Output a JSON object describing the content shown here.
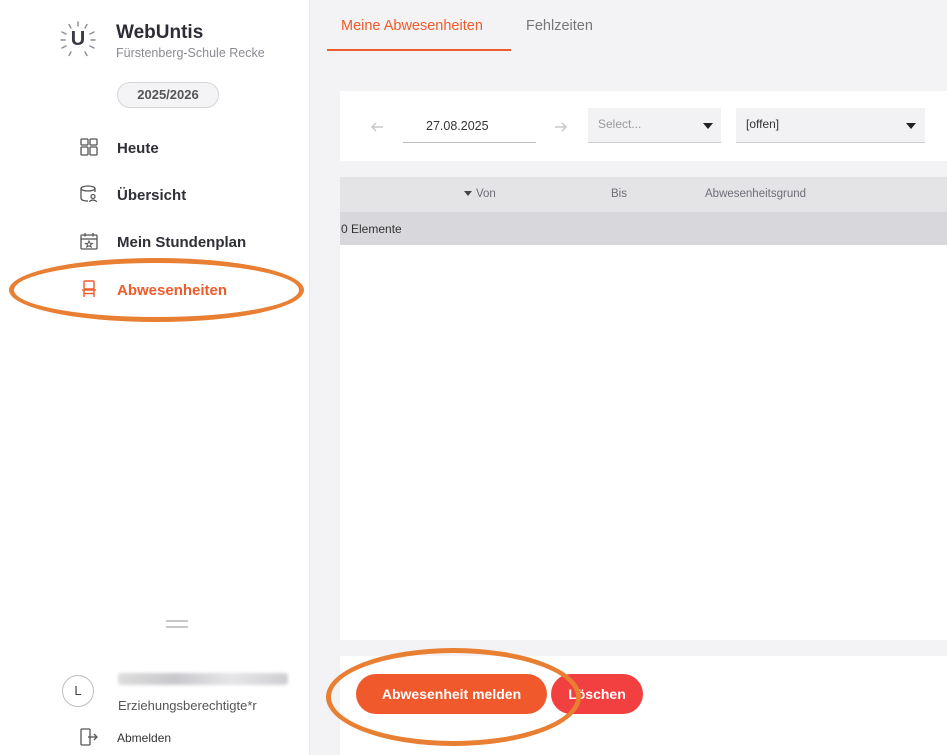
{
  "app": {
    "name": "WebUntis",
    "school": "Fürstenberg-Schule Recke",
    "year": "2025/2026"
  },
  "sidebar": {
    "items": [
      {
        "label": "Heute",
        "icon": "grid-icon"
      },
      {
        "label": "Übersicht",
        "icon": "overview-icon"
      },
      {
        "label": "Mein Stundenplan",
        "icon": "calendar-icon"
      },
      {
        "label": "Abwesenheiten",
        "icon": "chair-icon",
        "active": true
      }
    ]
  },
  "user": {
    "initial": "L",
    "role": "Erziehungsberechtigte*r",
    "logout_label": "Abmelden"
  },
  "tabs": [
    {
      "label": "Meine Abwesenheiten",
      "active": true
    },
    {
      "label": "Fehlzeiten",
      "active": false
    }
  ],
  "filters": {
    "date": "27.08.2025",
    "select1_placeholder": "Select...",
    "select2_value": "[offen]"
  },
  "table": {
    "columns": [
      "Von",
      "Bis",
      "Abwesenheitsgrund"
    ],
    "group_label": "0 Elemente"
  },
  "actions": {
    "report_label": "Abwesenheit melden",
    "delete_label": "Löschen"
  },
  "colors": {
    "accent": "#ef5b2a",
    "danger": "#f23f3f",
    "highlight": "#e87f33"
  }
}
